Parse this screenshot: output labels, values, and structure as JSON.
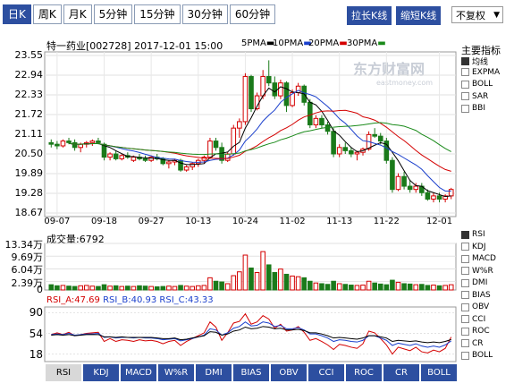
{
  "tabs": [
    {
      "label": "日K",
      "active": true
    },
    {
      "label": "周K",
      "active": false
    },
    {
      "label": "月K",
      "active": false
    },
    {
      "label": "5分钟",
      "active": false
    },
    {
      "label": "15分钟",
      "active": false
    },
    {
      "label": "30分钟",
      "active": false
    },
    {
      "label": "60分钟",
      "active": false
    }
  ],
  "toolbar": {
    "stretch": "拉长K线",
    "shrink": "缩短K线",
    "adjust": "不复权"
  },
  "header": {
    "stock": "特一药业[002728]",
    "datetime": "2017-12-01 15:00"
  },
  "ma_legend": [
    {
      "label": "5PMA",
      "color": "#000000"
    },
    {
      "label": "10PMA",
      "color": "#1a3fcc"
    },
    {
      "label": "20PMA",
      "color": "#d40000"
    },
    {
      "label": "30PMA",
      "color": "#1a8a1a"
    }
  ],
  "logo": {
    "name": "东方财富网",
    "domain": "eastmoney.com"
  },
  "side_indicators": {
    "title": "主要指标",
    "items": [
      {
        "label": "均线",
        "checked": true
      },
      {
        "label": "EXPMA",
        "checked": false
      },
      {
        "label": "BOLL",
        "checked": false
      },
      {
        "label": "SAR",
        "checked": false
      },
      {
        "label": "BBI",
        "checked": false
      }
    ]
  },
  "side_sub": [
    {
      "label": "RSI",
      "checked": true
    },
    {
      "label": "KDJ",
      "checked": false
    },
    {
      "label": "MACD",
      "checked": false
    },
    {
      "label": "W%R",
      "checked": false
    },
    {
      "label": "DMI",
      "checked": false
    },
    {
      "label": "BIAS",
      "checked": false
    },
    {
      "label": "OBV",
      "checked": false
    },
    {
      "label": "CCI",
      "checked": false
    },
    {
      "label": "ROC",
      "checked": false
    },
    {
      "label": "CR",
      "checked": false
    },
    {
      "label": "BOLL",
      "checked": false
    }
  ],
  "volume": {
    "label": "成交量:6792",
    "ticks": [
      "13.34万",
      "9.69万",
      "6.04万",
      "2.39万",
      "0"
    ]
  },
  "rsi": {
    "a": "RSI_A:47.69",
    "b": "RSI_B:40.93",
    "c": "RSI_C:43.33",
    "ticks": [
      "90",
      "54",
      "18"
    ]
  },
  "bottom_tabs": [
    "RSI",
    "KDJ",
    "MACD",
    "W%R",
    "DMI",
    "BIAS",
    "OBV",
    "CCI",
    "ROC",
    "CR",
    "BOLL"
  ],
  "colors": {
    "up": "#d40000",
    "down": "#1a7a1a",
    "accent": "#2d4fa0"
  },
  "chart_data": [
    {
      "type": "candlestick",
      "title": "特一药业[002728]",
      "y_ticks": [
        "23.55",
        "22.94",
        "22.33",
        "21.72",
        "21.11",
        "20.50",
        "19.89",
        "19.28",
        "18.67"
      ],
      "ylim": [
        18.67,
        23.55
      ],
      "x_ticks": [
        "09-07",
        "09-18",
        "09-27",
        "10-13",
        "10-24",
        "11-02",
        "11-13",
        "11-22",
        "12-01"
      ],
      "candles": [
        [
          20.85,
          20.95,
          20.7,
          20.8
        ],
        [
          20.8,
          20.9,
          20.65,
          20.75
        ],
        [
          20.75,
          20.95,
          20.7,
          20.9
        ],
        [
          20.9,
          21.0,
          20.8,
          20.85
        ],
        [
          20.85,
          20.95,
          20.6,
          20.7
        ],
        [
          20.7,
          20.85,
          20.55,
          20.8
        ],
        [
          20.8,
          20.9,
          20.7,
          20.85
        ],
        [
          20.85,
          20.95,
          20.75,
          20.9
        ],
        [
          20.9,
          21.0,
          20.8,
          20.85
        ],
        [
          20.8,
          20.85,
          20.3,
          20.4
        ],
        [
          20.4,
          20.55,
          20.3,
          20.5
        ],
        [
          20.5,
          20.6,
          20.3,
          20.35
        ],
        [
          20.35,
          20.5,
          20.3,
          20.45
        ],
        [
          20.45,
          20.55,
          20.35,
          20.4
        ],
        [
          20.3,
          20.45,
          20.25,
          20.4
        ],
        [
          20.4,
          20.5,
          20.3,
          20.35
        ],
        [
          20.35,
          20.45,
          20.25,
          20.3
        ],
        [
          20.3,
          20.45,
          20.25,
          20.4
        ],
        [
          20.4,
          20.5,
          20.3,
          20.35
        ],
        [
          20.35,
          20.4,
          20.15,
          20.2
        ],
        [
          20.2,
          20.3,
          20.05,
          20.25
        ],
        [
          20.25,
          20.35,
          20.15,
          20.3
        ],
        [
          20.3,
          20.35,
          19.95,
          20.0
        ],
        [
          20.0,
          20.15,
          19.95,
          20.1
        ],
        [
          20.1,
          20.25,
          20.0,
          20.2
        ],
        [
          20.2,
          20.35,
          20.1,
          20.3
        ],
        [
          20.3,
          20.45,
          20.2,
          20.4
        ],
        [
          20.4,
          21.0,
          20.35,
          20.9
        ],
        [
          20.9,
          21.0,
          20.6,
          20.7
        ],
        [
          20.7,
          20.85,
          20.2,
          20.3
        ],
        [
          20.3,
          20.55,
          20.25,
          20.5
        ],
        [
          20.5,
          21.4,
          20.45,
          21.3
        ],
        [
          21.3,
          21.6,
          21.0,
          21.5
        ],
        [
          21.5,
          23.0,
          21.4,
          22.9
        ],
        [
          22.9,
          22.95,
          21.8,
          21.9
        ],
        [
          21.9,
          22.4,
          21.85,
          22.3
        ],
        [
          22.3,
          23.1,
          22.2,
          22.9
        ],
        [
          22.9,
          23.4,
          22.6,
          22.7
        ],
        [
          22.7,
          22.9,
          22.2,
          22.3
        ],
        [
          22.3,
          22.8,
          22.2,
          22.7
        ],
        [
          22.7,
          22.75,
          21.8,
          22.0
        ],
        [
          22.0,
          22.5,
          21.95,
          22.4
        ],
        [
          22.4,
          22.7,
          22.3,
          22.6
        ],
        [
          22.6,
          22.65,
          22.0,
          22.1
        ],
        [
          22.1,
          22.2,
          21.3,
          21.4
        ],
        [
          21.4,
          21.7,
          21.3,
          21.6
        ],
        [
          21.6,
          21.7,
          21.3,
          21.4
        ],
        [
          21.4,
          21.5,
          21.1,
          21.2
        ],
        [
          21.2,
          21.3,
          20.4,
          20.5
        ],
        [
          20.5,
          20.8,
          20.4,
          20.7
        ],
        [
          20.7,
          20.85,
          20.5,
          20.6
        ],
        [
          20.6,
          20.7,
          20.4,
          20.5
        ],
        [
          20.5,
          20.6,
          20.3,
          20.55
        ],
        [
          20.55,
          20.7,
          20.45,
          20.65
        ],
        [
          20.65,
          21.2,
          20.6,
          21.1
        ],
        [
          21.1,
          21.3,
          21.0,
          21.05
        ],
        [
          21.05,
          21.15,
          20.8,
          20.9
        ],
        [
          20.9,
          21.0,
          20.2,
          20.3
        ],
        [
          20.3,
          20.4,
          19.3,
          19.4
        ],
        [
          19.4,
          19.9,
          19.35,
          19.8
        ],
        [
          19.8,
          19.95,
          19.4,
          19.5
        ],
        [
          19.5,
          19.7,
          19.3,
          19.4
        ],
        [
          19.4,
          19.6,
          19.3,
          19.5
        ],
        [
          19.5,
          19.6,
          19.2,
          19.3
        ],
        [
          19.3,
          19.4,
          19.05,
          19.1
        ],
        [
          19.1,
          19.3,
          19.0,
          19.2
        ],
        [
          19.2,
          19.3,
          19.0,
          19.1
        ],
        [
          19.1,
          19.25,
          19.0,
          19.2
        ],
        [
          19.2,
          19.45,
          19.1,
          19.4
        ]
      ]
    },
    {
      "type": "bar",
      "title": "成交量",
      "ylim": [
        0,
        13.34
      ],
      "values": [
        1.5,
        1.2,
        1.3,
        1.1,
        1.0,
        1.2,
        1.3,
        1.1,
        1.0,
        1.5,
        1.1,
        1.2,
        1.0,
        1.1,
        1.0,
        1.2,
        1.1,
        1.0,
        0.9,
        1.0,
        1.1,
        1.0,
        1.3,
        1.1,
        1.0,
        1.2,
        1.3,
        3.5,
        2.5,
        2.3,
        1.8,
        4.1,
        5.2,
        10.0,
        6.3,
        5.0,
        11.0,
        7.2,
        5.0,
        6.0,
        4.5,
        4.0,
        3.8,
        3.5,
        2.5,
        2.0,
        1.8,
        1.6,
        2.5,
        1.8,
        1.6,
        1.4,
        1.3,
        1.4,
        2.5,
        2.0,
        1.7,
        1.5,
        2.8,
        2.2,
        1.8,
        1.7,
        1.5,
        1.6,
        1.3,
        1.4,
        1.2,
        1.3,
        1.5
      ]
    },
    {
      "type": "line",
      "title": "RSI",
      "ylim": [
        0,
        100
      ],
      "series": [
        {
          "name": "RSI_A",
          "color": "#d40000",
          "values": [
            52,
            55,
            52,
            56,
            50,
            52,
            54,
            55,
            56,
            40,
            45,
            40,
            43,
            42,
            40,
            43,
            41,
            42,
            40,
            36,
            40,
            42,
            33,
            40,
            45,
            50,
            55,
            74,
            65,
            42,
            55,
            72,
            75,
            88,
            70,
            74,
            85,
            79,
            63,
            70,
            58,
            60,
            66,
            56,
            42,
            45,
            40,
            34,
            26,
            35,
            33,
            30,
            28,
            36,
            58,
            55,
            45,
            34,
            18,
            30,
            27,
            24,
            30,
            22,
            20,
            25,
            22,
            28,
            47.69
          ]
        },
        {
          "name": "RSI_B",
          "color": "#1a3fcc",
          "values": [
            52,
            53,
            52,
            54,
            51,
            52,
            53,
            53,
            54,
            47,
            48,
            46,
            47,
            47,
            46,
            47,
            46,
            46,
            45,
            43,
            44,
            45,
            41,
            43,
            45,
            48,
            51,
            62,
            60,
            51,
            55,
            63,
            66,
            74,
            67,
            68,
            74,
            72,
            66,
            68,
            62,
            62,
            64,
            60,
            53,
            53,
            50,
            46,
            40,
            43,
            42,
            40,
            39,
            42,
            50,
            50,
            46,
            42,
            33,
            37,
            35,
            33,
            36,
            32,
            30,
            32,
            30,
            34,
            40.93
          ]
        },
        {
          "name": "RSI_C",
          "color": "#000000",
          "values": [
            51,
            52,
            51,
            52,
            50,
            51,
            52,
            52,
            52,
            48,
            48,
            47,
            48,
            47,
            47,
            47,
            47,
            47,
            46,
            45,
            45,
            46,
            43,
            44,
            46,
            48,
            50,
            57,
            56,
            51,
            53,
            58,
            60,
            65,
            62,
            63,
            66,
            65,
            62,
            63,
            60,
            60,
            61,
            59,
            55,
            55,
            53,
            50,
            46,
            47,
            46,
            45,
            44,
            46,
            50,
            50,
            48,
            46,
            40,
            42,
            41,
            40,
            41,
            39,
            38,
            39,
            38,
            40,
            43.33
          ]
        }
      ],
      "y_ticks": [
        "90",
        "54",
        "18"
      ]
    }
  ]
}
